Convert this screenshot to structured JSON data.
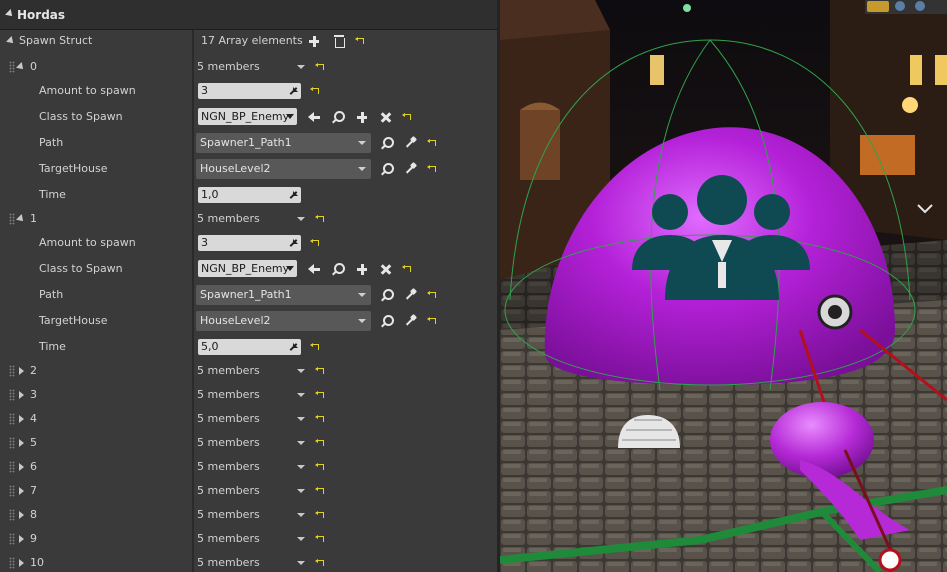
{
  "panel": {
    "title": "Hordas",
    "spawn_struct": {
      "label": "Spawn Struct",
      "value": "17 Array elements"
    },
    "members_text": "5 members",
    "fields": {
      "amount": "Amount to spawn",
      "class": "Class to Spawn",
      "path": "Path",
      "target": "TargetHouse",
      "time": "Time"
    },
    "expanded_elements": [
      {
        "index": "0",
        "amount": "3",
        "class": "NGN_BP_Enemy",
        "path": "Spawner1_Path1",
        "target": "HouseLevel2",
        "time": "1,0"
      },
      {
        "index": "1",
        "amount": "3",
        "class": "NGN_BP_Enemy",
        "path": "Spawner1_Path1",
        "target": "HouseLevel2",
        "time": "5,0"
      }
    ],
    "collapsed_elements": [
      "2",
      "3",
      "4",
      "5",
      "6",
      "7",
      "8",
      "9",
      "10"
    ]
  },
  "viewport": {
    "colors": {
      "dome": "#b421d8",
      "icon": "#0f4a52",
      "wire": "#2fa24b",
      "ray": "#b3101c"
    }
  }
}
